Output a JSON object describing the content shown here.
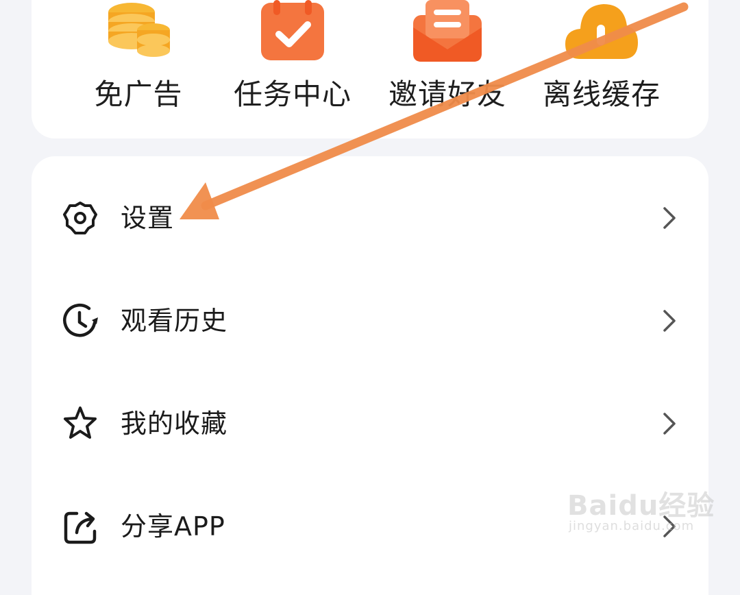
{
  "quick_actions": [
    {
      "label": "免广告",
      "icon": "coins-icon",
      "color": "#f5a623"
    },
    {
      "label": "任务中心",
      "icon": "calendar-check-icon",
      "color": "#f4753f"
    },
    {
      "label": "邀请好友",
      "icon": "envelope-icon",
      "color": "#f4753f"
    },
    {
      "label": "离线缓存",
      "icon": "cloud-download-icon",
      "color": "#f5a01c"
    }
  ],
  "menu": [
    {
      "label": "设置",
      "icon": "gear-icon"
    },
    {
      "label": "观看历史",
      "icon": "history-clock-icon"
    },
    {
      "label": "我的收藏",
      "icon": "star-icon"
    },
    {
      "label": "分享APP",
      "icon": "share-icon"
    }
  ],
  "annotation": {
    "color": "#f08c4a",
    "points_to": "设置"
  },
  "watermark": {
    "main": "Baidu经验",
    "url": "jingyan.baidu.com"
  }
}
